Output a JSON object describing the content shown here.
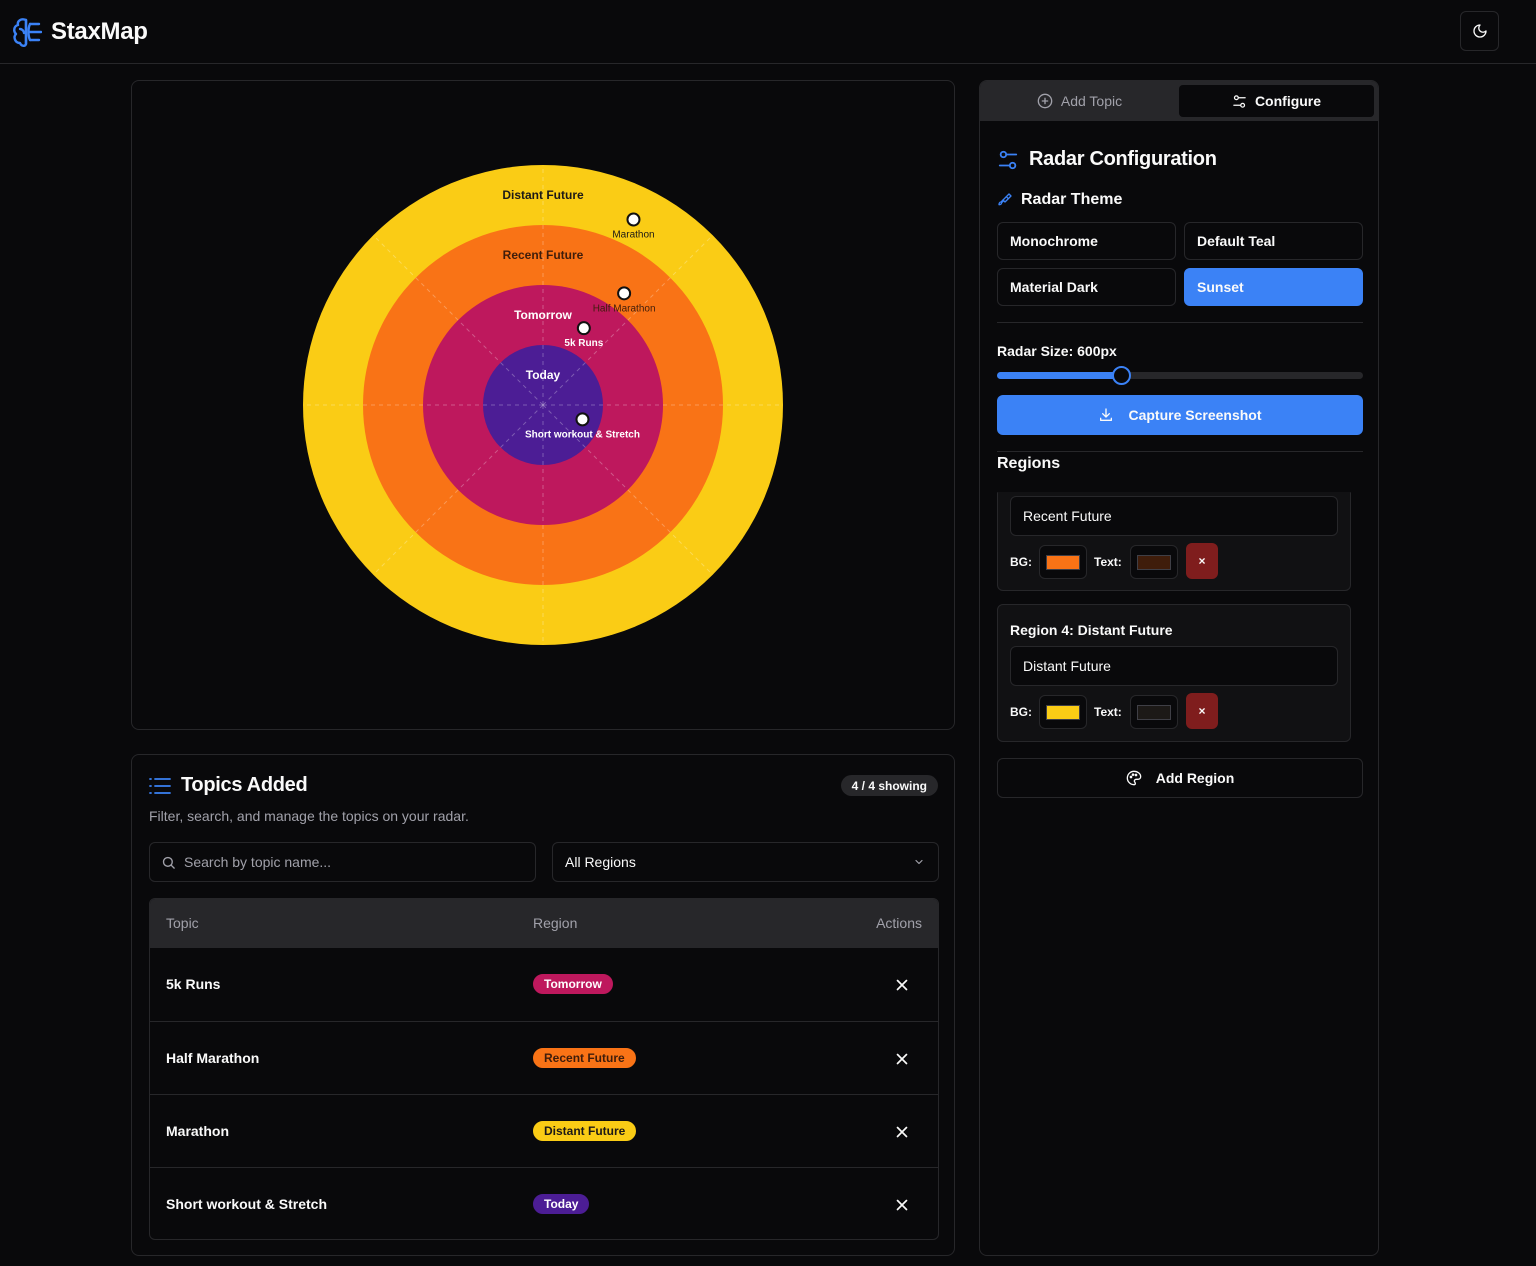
{
  "app": {
    "title": "StaxMap"
  },
  "colors": {
    "accent": "#3b82f6",
    "today": "#4c1d95",
    "tomorrow": "#be185d",
    "recent_future": "#f97316",
    "distant_future": "#facc15",
    "delete": "#7f1d1d"
  },
  "radar": {
    "rings": [
      {
        "label": "Distant Future",
        "color": "#facc15",
        "text_color": "#1c1917"
      },
      {
        "label": "Recent Future",
        "color": "#f97316",
        "text_color": "#3f1d0b"
      },
      {
        "label": "Tomorrow",
        "color": "#be185d",
        "text_color": "#ffffff"
      },
      {
        "label": "Today",
        "color": "#4c1d95",
        "text_color": "#ffffff"
      }
    ],
    "points": [
      {
        "label": "Marathon",
        "ring": "Distant Future"
      },
      {
        "label": "Half Marathon",
        "ring": "Recent Future"
      },
      {
        "label": "5k Runs",
        "ring": "Tomorrow"
      },
      {
        "label": "Short workout & Stretch",
        "ring": "Today"
      }
    ]
  },
  "topics": {
    "title": "Topics Added",
    "showing": "4 / 4 showing",
    "description": "Filter, search, and manage the topics on your radar.",
    "search_placeholder": "Search by topic name...",
    "region_filter": "All Regions",
    "columns": {
      "topic": "Topic",
      "region": "Region",
      "actions": "Actions"
    },
    "rows": [
      {
        "name": "5k Runs",
        "region": "Tomorrow",
        "bg": "#be185d",
        "fg": "#ffffff"
      },
      {
        "name": "Half Marathon",
        "region": "Recent Future",
        "bg": "#f97316",
        "fg": "#3f1d0b"
      },
      {
        "name": "Marathon",
        "region": "Distant Future",
        "bg": "#facc15",
        "fg": "#1c1917"
      },
      {
        "name": "Short workout & Stretch",
        "region": "Today",
        "bg": "#4c1d95",
        "fg": "#ffffff"
      }
    ]
  },
  "config": {
    "tabs": {
      "add": "Add Topic",
      "configure": "Configure"
    },
    "title": "Radar Configuration",
    "theme_title": "Radar Theme",
    "themes": [
      "Monochrome",
      "Default Teal",
      "Material Dark",
      "Sunset"
    ],
    "active_theme": "Sunset",
    "size_label": "Radar Size: 600px",
    "size_fraction": 0.34,
    "capture_label": "Capture Screenshot",
    "regions_label": "Regions",
    "regions": [
      {
        "title": "",
        "name": "Recent Future",
        "bg": "#f97316",
        "text": "#3f1d0b"
      },
      {
        "title": "Region 4: Distant Future",
        "name": "Distant Future",
        "bg": "#facc15",
        "text": "#1c1917"
      }
    ],
    "bg_label": "BG:",
    "text_label": "Text:",
    "delete_glyph": "×",
    "add_region_label": "Add Region"
  }
}
